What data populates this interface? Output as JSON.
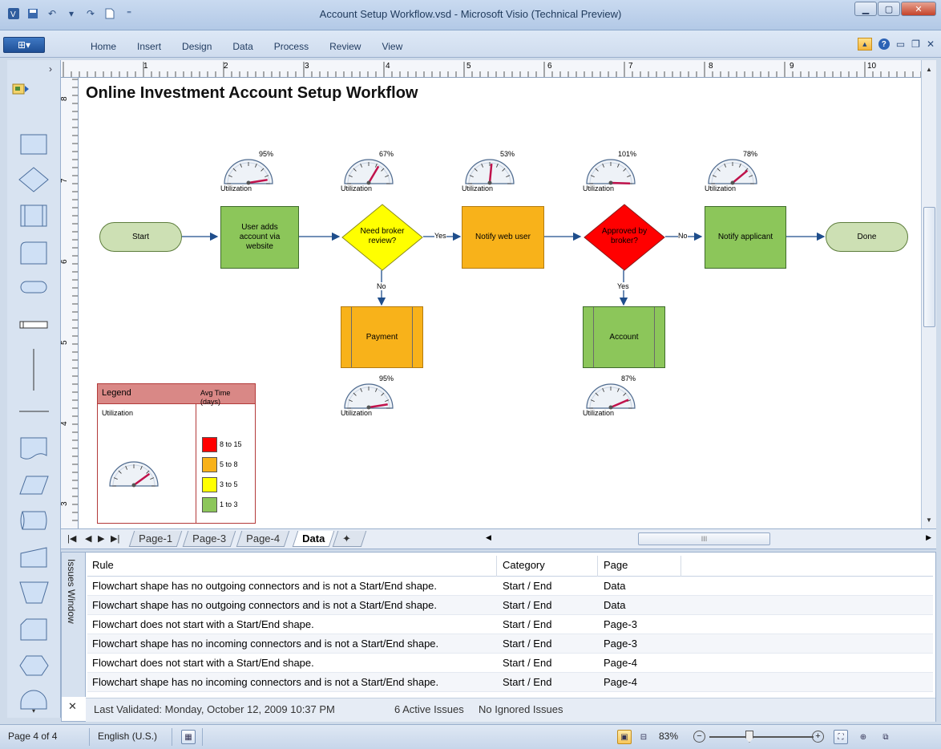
{
  "window": {
    "title": "Account Setup Workflow.vsd  -  Microsoft Visio (Technical Preview)"
  },
  "ribbon": {
    "file_label": "⊞▾",
    "tabs": [
      "Home",
      "Insert",
      "Design",
      "Data",
      "Process",
      "Review",
      "View"
    ]
  },
  "drawing": {
    "heading": "Online Investment Account Setup Workflow",
    "ruler_h": [
      "1",
      "2",
      "3",
      "4",
      "5",
      "6",
      "7",
      "8",
      "9",
      "10"
    ],
    "ruler_v": [
      "8",
      "7",
      "6",
      "5",
      "4",
      "3"
    ],
    "shapes": {
      "start": "Start",
      "user_adds": "User adds account via website",
      "need_broker": "Need broker review?",
      "notify_web": "Notify web user",
      "approved": "Approved by broker?",
      "notify_applicant": "Notify applicant",
      "done": "Done",
      "payment": "Payment",
      "account": "Account"
    },
    "connector_labels": {
      "yes1": "Yes",
      "no1": "No",
      "no2": "No",
      "yes2": "Yes"
    },
    "gauges": {
      "label": "Utilization",
      "user_adds": {
        "pct": "95%",
        "level": 0.95
      },
      "need_broker": {
        "pct": "67%",
        "level": 0.67
      },
      "notify_web": {
        "pct": "53%",
        "level": 0.53
      },
      "approved": {
        "pct": "101%",
        "level": 1.01
      },
      "notify_applicant": {
        "pct": "78%",
        "level": 0.78
      },
      "payment": {
        "pct": "95%",
        "level": 0.95
      },
      "account": {
        "pct": "87%",
        "level": 0.87
      }
    },
    "legend": {
      "title": "Legend",
      "col1": "Utilization",
      "col2": "Avg Time (days)",
      "items": [
        {
          "label": "8 to 15",
          "color": "#ff0000"
        },
        {
          "label": "5 to 8",
          "color": "#f8b21a"
        },
        {
          "label": "3 to 5",
          "color": "#ffff00"
        },
        {
          "label": "1 to 3",
          "color": "#8cc65a"
        }
      ]
    },
    "colors": {
      "process_green": "#8cc65a",
      "process_orange": "#f8b21a",
      "decision_yellow": "#ffff00",
      "decision_red": "#ff0000",
      "terminator": "#cde0b4"
    }
  },
  "page_tabs": [
    "Page-1",
    "Page-3",
    "Page-4",
    "Data"
  ],
  "active_page": "Data",
  "issues": {
    "window_title": "Issues Window",
    "headers": [
      "Rule",
      "Category",
      "Page"
    ],
    "rows": [
      [
        "Flowchart shape has no outgoing connectors and is not a Start/End shape.",
        "Start / End",
        "Data"
      ],
      [
        "Flowchart shape has no outgoing connectors and is not a Start/End shape.",
        "Start / End",
        "Data"
      ],
      [
        "Flowchart does not start with a Start/End shape.",
        "Start / End",
        "Page-3"
      ],
      [
        "Flowchart shape has no incoming connectors and is not a Start/End shape.",
        "Start / End",
        "Page-3"
      ],
      [
        "Flowchart does not start with a Start/End shape.",
        "Start / End",
        "Page-4"
      ],
      [
        "Flowchart shape has no incoming connectors and is not a Start/End shape.",
        "Start / End",
        "Page-4"
      ]
    ],
    "status": {
      "last_validated": "Last Validated: Monday, October 12, 2009 10:37 PM",
      "active": "6 Active Issues",
      "ignored": "No Ignored Issues"
    }
  },
  "statusbar": {
    "page": "Page 4 of 4",
    "language": "English (U.S.)",
    "zoom": "83%"
  }
}
